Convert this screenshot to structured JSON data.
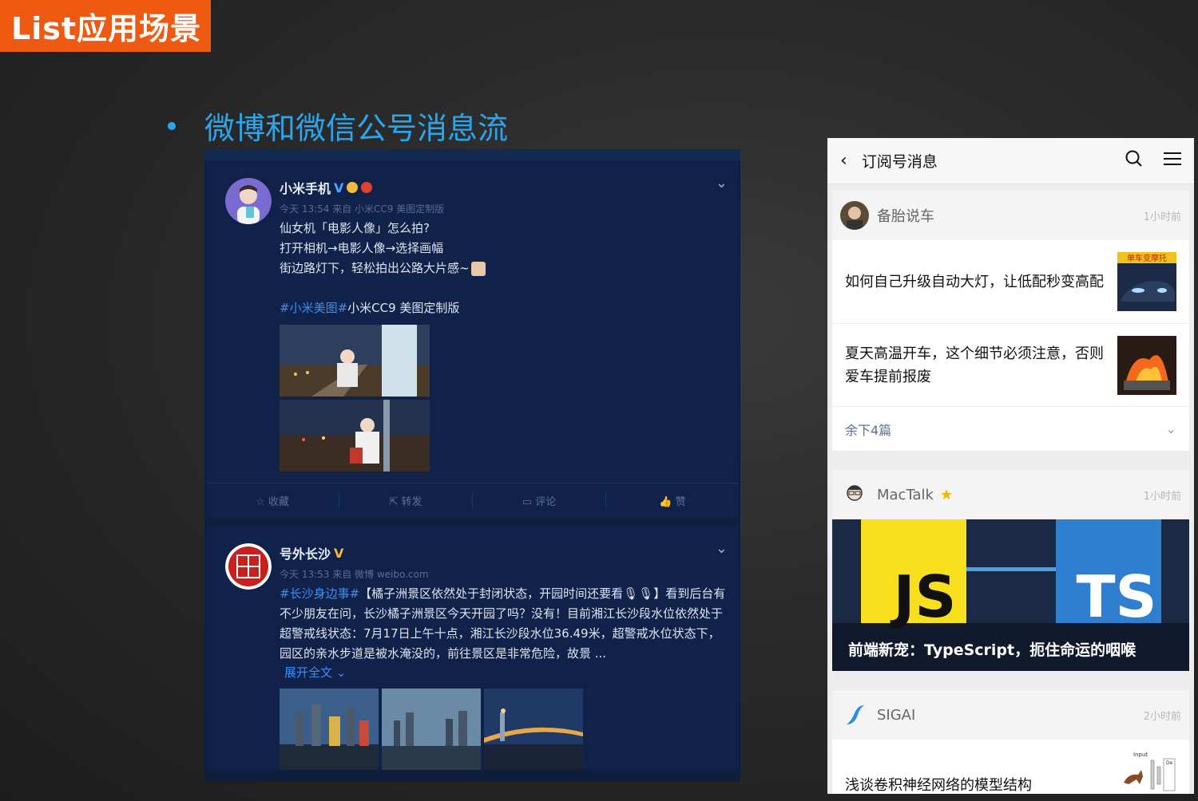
{
  "slide": {
    "badge": "List应用场景",
    "bullet": "微博和微信公号消息流"
  },
  "weibo": {
    "posts": [
      {
        "user": "小米手机",
        "verified": "V",
        "meta": "今天 13:54 来自 小米CC9 美图定制版",
        "lines": [
          "仙女机「电影人像」怎么拍?",
          "打开相机→电影人像→选择画幅",
          "街边路灯下，轻松拍出公路大片感~"
        ],
        "tag": "#小米美图#",
        "tag_tail": "小米CC9 美图定制版"
      },
      {
        "user": "号外长沙",
        "verified": "V",
        "meta": "今天 13:53 来自 微博 weibo.com",
        "tag": "#长沙身边事#",
        "text": "【橘子洲景区依然处于封闭状态，开园时间还要看🎙🎙】看到后台有不少朋友在问，长沙橘子洲景区今天开园了吗？没有！目前湘江长沙段水位依然处于超警戒线状态：7月17日上午十点，湘江长沙段水位36.49米，超警戒水位状态下，园区的亲水步道是被水淹没的，前往景区是非常危险，故景 ...",
        "expand": "展开全文 ⌄"
      }
    ],
    "actions": [
      "收藏",
      "转发",
      "评论",
      "赞"
    ]
  },
  "wechat": {
    "title": "订阅号消息",
    "accounts": [
      {
        "name": "备胎说车",
        "time": "1小时前",
        "articles": [
          {
            "title": "如何自己升级自动大灯，让低配秒变高配",
            "thumb_label": "单车变摩托"
          },
          {
            "title": "夏天高温开车，这个细节必须注意，否则爱车提前报废"
          }
        ],
        "more": "余下4篇"
      },
      {
        "name": "MacTalk",
        "time": "1小时前",
        "cover_left": "JS",
        "cover_right": "TS",
        "cover_title": "前端新宠：TypeScript，扼住命运的咽喉"
      },
      {
        "name": "SIGAI",
        "time": "2小时前",
        "articles": [
          {
            "title": "浅谈卷积神经网络的模型结构",
            "thumb_label_top": "Input",
            "thumb_label_side": "De"
          }
        ]
      }
    ]
  }
}
